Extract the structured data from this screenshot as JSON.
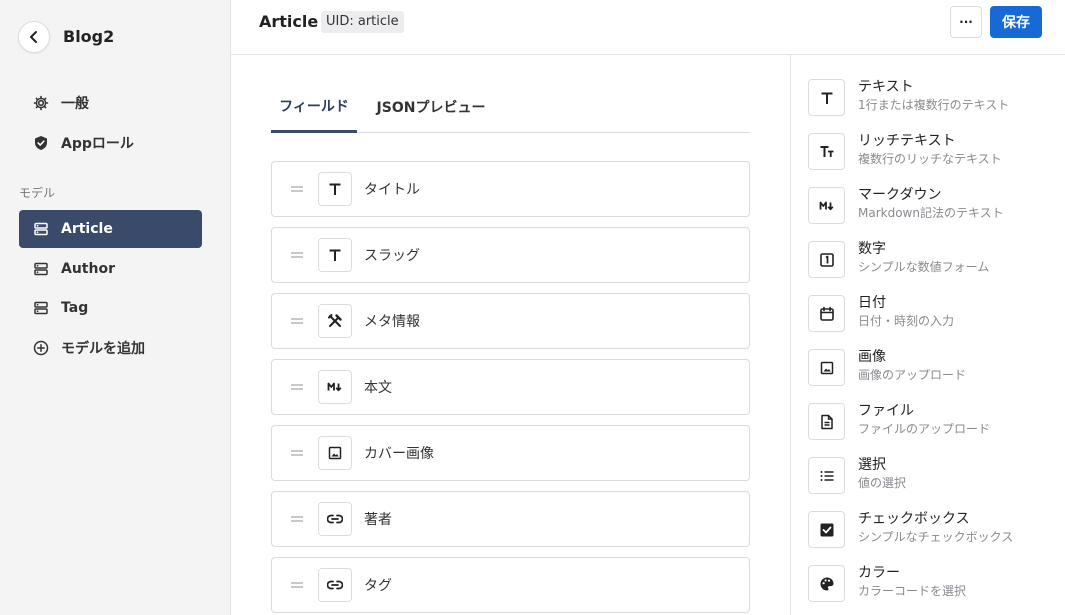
{
  "sidebar": {
    "project_title": "Blog2",
    "items": [
      {
        "label": "一般"
      },
      {
        "label": "Appロール"
      }
    ],
    "section_label": "モデル",
    "models": [
      {
        "label": "Article"
      },
      {
        "label": "Author"
      },
      {
        "label": "Tag"
      }
    ],
    "add_model_label": "モデルを追加"
  },
  "header": {
    "title": "Article",
    "uid": "UID: article",
    "more_label": "···",
    "save_label": "保存"
  },
  "main": {
    "tabs": [
      {
        "label": "フィールド",
        "active": true
      },
      {
        "label": "JSONプレビュー",
        "active": false
      }
    ],
    "fields": [
      {
        "label": "タイトル",
        "icon": "text-icon"
      },
      {
        "label": "スラッグ",
        "icon": "text-icon"
      },
      {
        "label": "メタ情報",
        "icon": "tools-icon"
      },
      {
        "label": "本文",
        "icon": "markdown-icon"
      },
      {
        "label": "カバー画像",
        "icon": "image-icon"
      },
      {
        "label": "著者",
        "icon": "link-icon"
      },
      {
        "label": "タグ",
        "icon": "link-icon"
      }
    ]
  },
  "field_types": [
    {
      "name": "テキスト",
      "desc": "1行または複数行のテキスト",
      "icon": "text-icon"
    },
    {
      "name": "リッチテキスト",
      "desc": "複数行のリッチなテキスト",
      "icon": "rich-text-icon"
    },
    {
      "name": "マークダウン",
      "desc": "Markdown記法のテキスト",
      "icon": "markdown-icon"
    },
    {
      "name": "数字",
      "desc": "シンプルな数値フォーム",
      "icon": "number-icon"
    },
    {
      "name": "日付",
      "desc": "日付・時刻の入力",
      "icon": "calendar-icon"
    },
    {
      "name": "画像",
      "desc": "画像のアップロード",
      "icon": "image-icon"
    },
    {
      "name": "ファイル",
      "desc": "ファイルのアップロード",
      "icon": "file-icon"
    },
    {
      "name": "選択",
      "desc": "値の選択",
      "icon": "list-icon"
    },
    {
      "name": "チェックボックス",
      "desc": "シンプルなチェックボックス",
      "icon": "checkbox-icon"
    },
    {
      "name": "カラー",
      "desc": "カラーコードを選択",
      "icon": "palette-icon"
    }
  ],
  "colors": {
    "active_nav": "#3a4a6b",
    "primary_button": "#1769d6"
  }
}
